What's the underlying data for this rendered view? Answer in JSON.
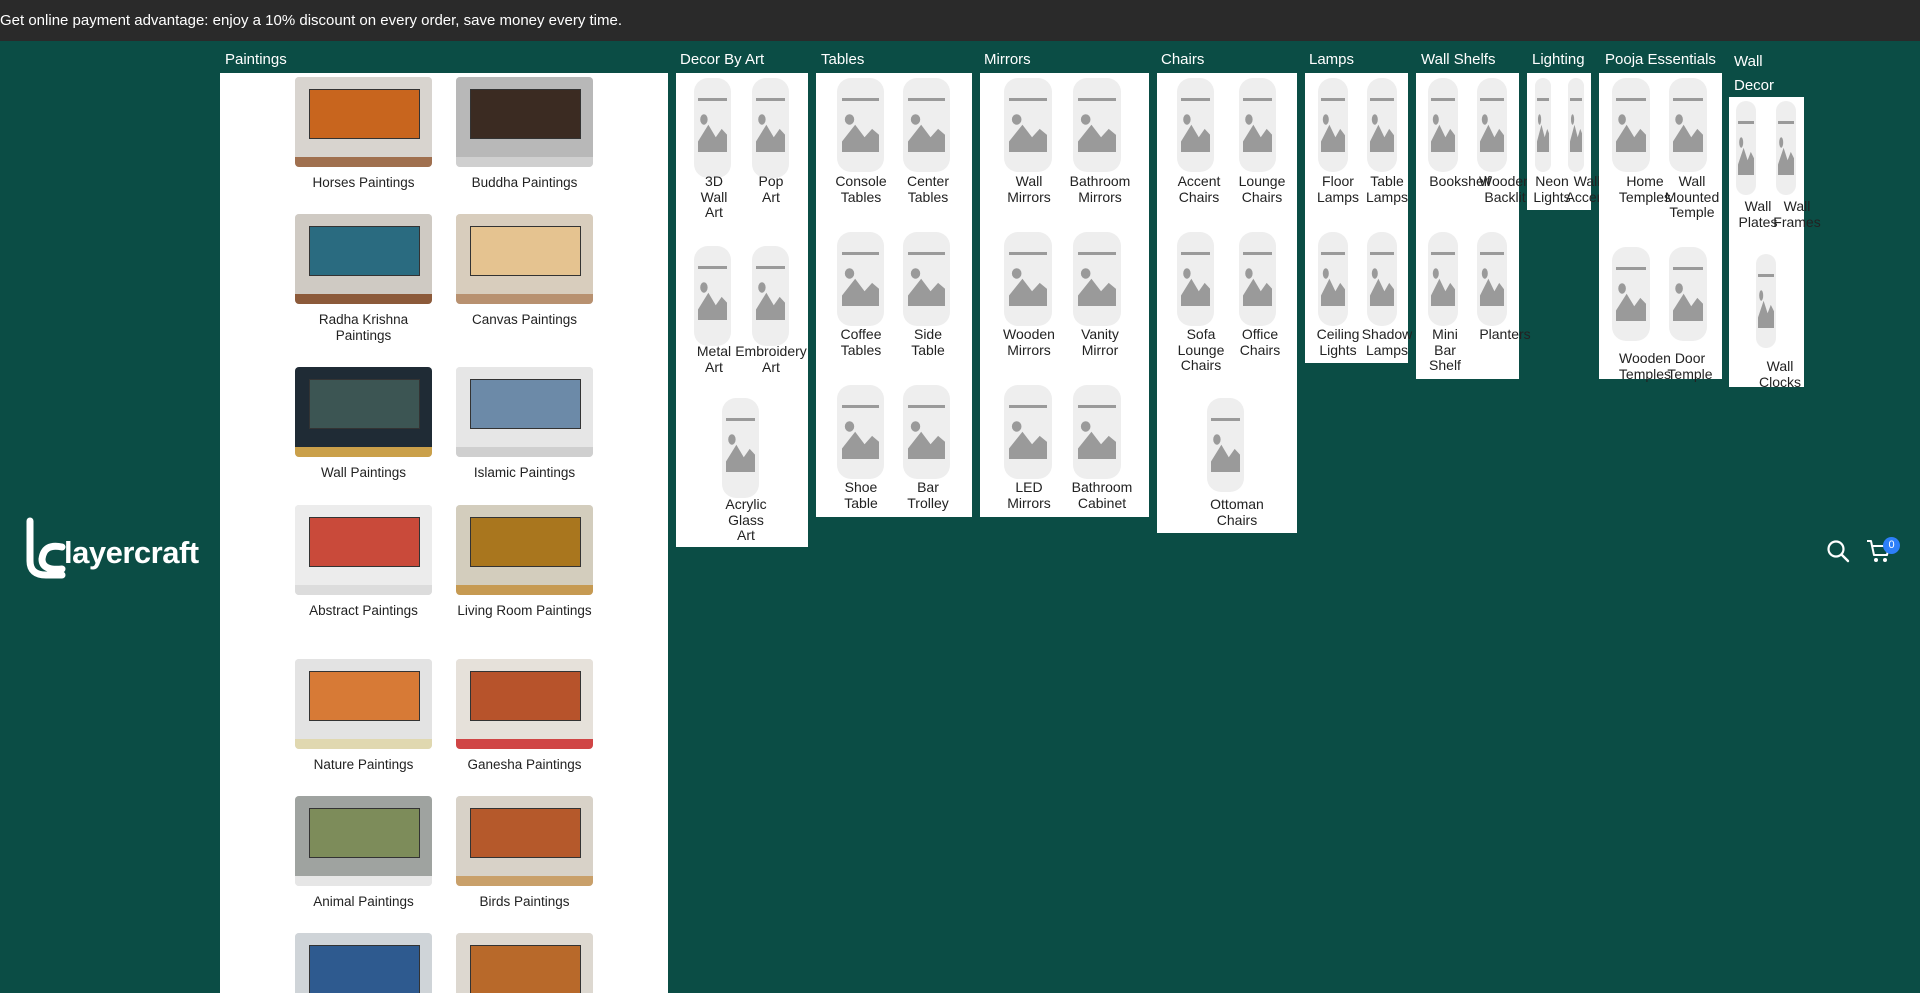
{
  "announcement": "Get online payment advantage: enjoy a 10% discount on every order, save money every time.",
  "logo_text": "layercraft",
  "cart_count": "0",
  "icons": {
    "search": "search-icon",
    "cart": "cart-icon",
    "placeholder": "image-placeholder-icon"
  },
  "colors": {
    "background": "#0b4d45",
    "announcement_bar": "#2a2a2a",
    "badge": "#2d7ff9",
    "panel": "#ffffff"
  },
  "menu": {
    "paintings": {
      "title": "Paintings",
      "items": [
        {
          "label": "Horses Paintings",
          "wall": "#d8d4cf",
          "art": "#c8651e",
          "floor": "#a0704f"
        },
        {
          "label": "Buddha Paintings",
          "wall": "#b8b8b8",
          "art": "#3b2b22",
          "floor": "#cfcfcf"
        },
        {
          "label": "Radha Krishna Paintings",
          "wall": "#cfcac3",
          "art": "#2a6b80",
          "floor": "#8c5a3a"
        },
        {
          "label": "Canvas Paintings",
          "wall": "#d8cdbd",
          "art": "#e5c390",
          "floor": "#b89170"
        },
        {
          "label": "Wall Paintings",
          "wall": "#1f2b35",
          "art": "#3c5553",
          "floor": "#caa04a"
        },
        {
          "label": "Islamic Paintings",
          "wall": "#e6e6e6",
          "art": "#6c8aa8",
          "floor": "#cfcfcf"
        },
        {
          "label": "Abstract Paintings",
          "wall": "#ececec",
          "art": "#c94a3a",
          "floor": "#dcdcdc"
        },
        {
          "label": "Living Room Paintings",
          "wall": "#d3cdbd",
          "art": "#a9761e",
          "floor": "#c69a52"
        },
        {
          "label": "Nature Paintings",
          "wall": "#e3e3e3",
          "art": "#d77a36",
          "floor": "#e0d8b0"
        },
        {
          "label": "Ganesha Paintings",
          "wall": "#e6e1da",
          "art": "#b7532b",
          "floor": "#d04545"
        },
        {
          "label": "Animal Paintings",
          "wall": "#9fa3a0",
          "art": "#7d8c5a",
          "floor": "#e6e6e6"
        },
        {
          "label": "Birds Paintings",
          "wall": "#d8d2c8",
          "art": "#b5592b",
          "floor": "#c9a06a"
        },
        {
          "label": "",
          "wall": "#cfd4d8",
          "art": "#2e5a8f",
          "floor": "#e0e0e0"
        },
        {
          "label": "",
          "wall": "#ddd8d0",
          "art": "#b8692a",
          "floor": "#d8d8d8"
        }
      ]
    },
    "categories": [
      {
        "key": "decor",
        "title": "Decor By Art",
        "items": [
          "3D Wall Art",
          "Pop Art",
          "Metal Art",
          "Embroidery Art",
          "Acrylic Glass Art"
        ]
      },
      {
        "key": "tables",
        "title": "Tables",
        "items": [
          "Console Tables",
          "Center Tables",
          "Coffee Tables",
          "Side Table",
          "Shoe Table",
          "Bar Trolley"
        ]
      },
      {
        "key": "mirrors",
        "title": "Mirrors",
        "items": [
          "Wall Mirrors",
          "Bathroom Mirrors",
          "Wooden Mirrors",
          "Vanity Mirror",
          "LED Mirrors",
          "Bathroom Cabinet"
        ]
      },
      {
        "key": "chairs",
        "title": "Chairs",
        "items": [
          "Accent Chairs",
          "Lounge Chairs",
          "Sofa Lounge Chairs",
          "Office Chairs",
          "Ottoman Chairs"
        ]
      },
      {
        "key": "lamps",
        "title": "Lamps",
        "items": [
          "Floor Lamps",
          "Table Lamps",
          "Ceiling Lights",
          "Shadow Lamps"
        ]
      },
      {
        "key": "shelfs",
        "title": "Wall Shelfs",
        "items": [
          "Bookshelf",
          "Wooden Backlit",
          "Mini Bar Shelf",
          "Planters"
        ]
      },
      {
        "key": "lighting",
        "title": "Lighting",
        "items": [
          "Neon Lights",
          "Wall Accent"
        ]
      },
      {
        "key": "pooja",
        "title": "Pooja Essentials",
        "items": [
          "Home Temples",
          "Wall Mounted Temple",
          "Wooden Temples",
          "Door Temple"
        ]
      },
      {
        "key": "walldecor",
        "title": "Wall Decor",
        "items": [
          "Wall Plates",
          "Wall Frames",
          "Wall Clocks"
        ]
      }
    ]
  }
}
